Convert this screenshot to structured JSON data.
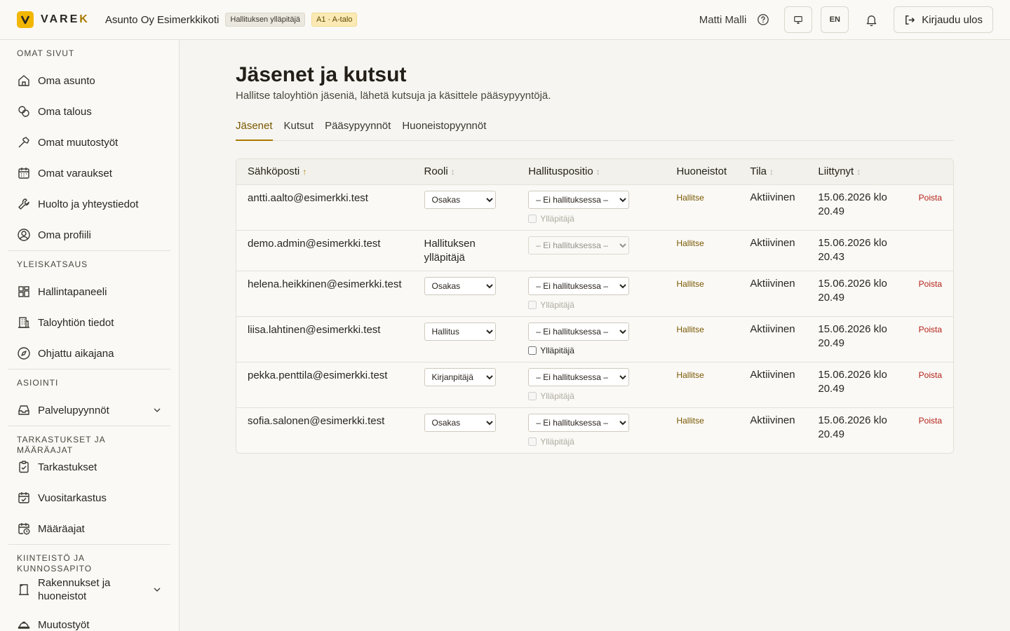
{
  "header": {
    "logo_text": "VAREK",
    "company": "Asunto Oy Esimerkkikoti",
    "role_badge": "Hallituksen ylläpitäjä",
    "apartment_badge": "A1 · A-talo",
    "user_name": "Matti Malli",
    "language": "EN",
    "logout_label": "Kirjaudu ulos"
  },
  "sidebar": {
    "sections": [
      {
        "heading": "OMAT SIVUT",
        "items": [
          "Oma asunto",
          "Oma talous",
          "Omat muutostyöt",
          "Omat varaukset",
          "Huolto ja yhteystiedot",
          "Oma profiili"
        ]
      },
      {
        "heading": "YLEISKATSAUS",
        "items": [
          "Hallintapaneeli",
          "Taloyhtiön tiedot",
          "Ohjattu aikajana"
        ]
      },
      {
        "heading": "ASIOINTI",
        "items": [
          "Palvelupyynnöt"
        ]
      },
      {
        "heading": "TARKASTUKSET JA MÄÄRÄAJAT",
        "items": [
          "Tarkastukset",
          "Vuositarkastus",
          "Määräajat"
        ]
      },
      {
        "heading": "KIINTEISTÖ JA KUNNOSSAPITO",
        "items": [
          "Rakennukset ja huoneistot",
          "Muutostyöt"
        ]
      }
    ]
  },
  "page": {
    "title": "Jäsenet ja kutsut",
    "subtitle": "Hallitse taloyhtiön jäseniä, lähetä kutsuja ja käsittele pääsypyyntöjä.",
    "tabs": [
      "Jäsenet",
      "Kutsut",
      "Pääsypyynnöt",
      "Huoneistopyynnöt"
    ]
  },
  "table": {
    "columns": [
      "Sähköposti",
      "Rooli",
      "Hallituspositio",
      "Huoneistot",
      "Tila",
      "Liittynyt"
    ],
    "manage_label": "Hallitse",
    "delete_label": "Poista",
    "admin_label": "Ylläpitäjä",
    "rows": [
      {
        "email": "antti.aalto@esimerkki.test",
        "role": "Osakas",
        "position": "– Ei hallituksessa –",
        "status": "Aktiivinen",
        "joined": "15.06.2026 klo 20.49"
      },
      {
        "email": "demo.admin@esimerkki.test",
        "role": "Hallituksen ylläpitäjä",
        "position": "– Ei hallituksessa –",
        "status": "Aktiivinen",
        "joined": "15.06.2026 klo 20.43"
      },
      {
        "email": "helena.heikkinen@esimerkki.test",
        "role": "Osakas",
        "position": "– Ei hallituksessa –",
        "status": "Aktiivinen",
        "joined": "15.06.2026 klo 20.49"
      },
      {
        "email": "liisa.lahtinen@esimerkki.test",
        "role": "Hallitus",
        "position": "– Ei hallituksessa –",
        "status": "Aktiivinen",
        "joined": "15.06.2026 klo 20.49"
      },
      {
        "email": "pekka.penttila@esimerkki.test",
        "role": "Kirjanpitäjä",
        "position": "– Ei hallituksessa –",
        "status": "Aktiivinen",
        "joined": "15.06.2026 klo 20.49"
      },
      {
        "email": "sofia.salonen@esimerkki.test",
        "role": "Osakas",
        "position": "– Ei hallituksessa –",
        "status": "Aktiivinen",
        "joined": "15.06.2026 klo 20.49"
      }
    ]
  }
}
